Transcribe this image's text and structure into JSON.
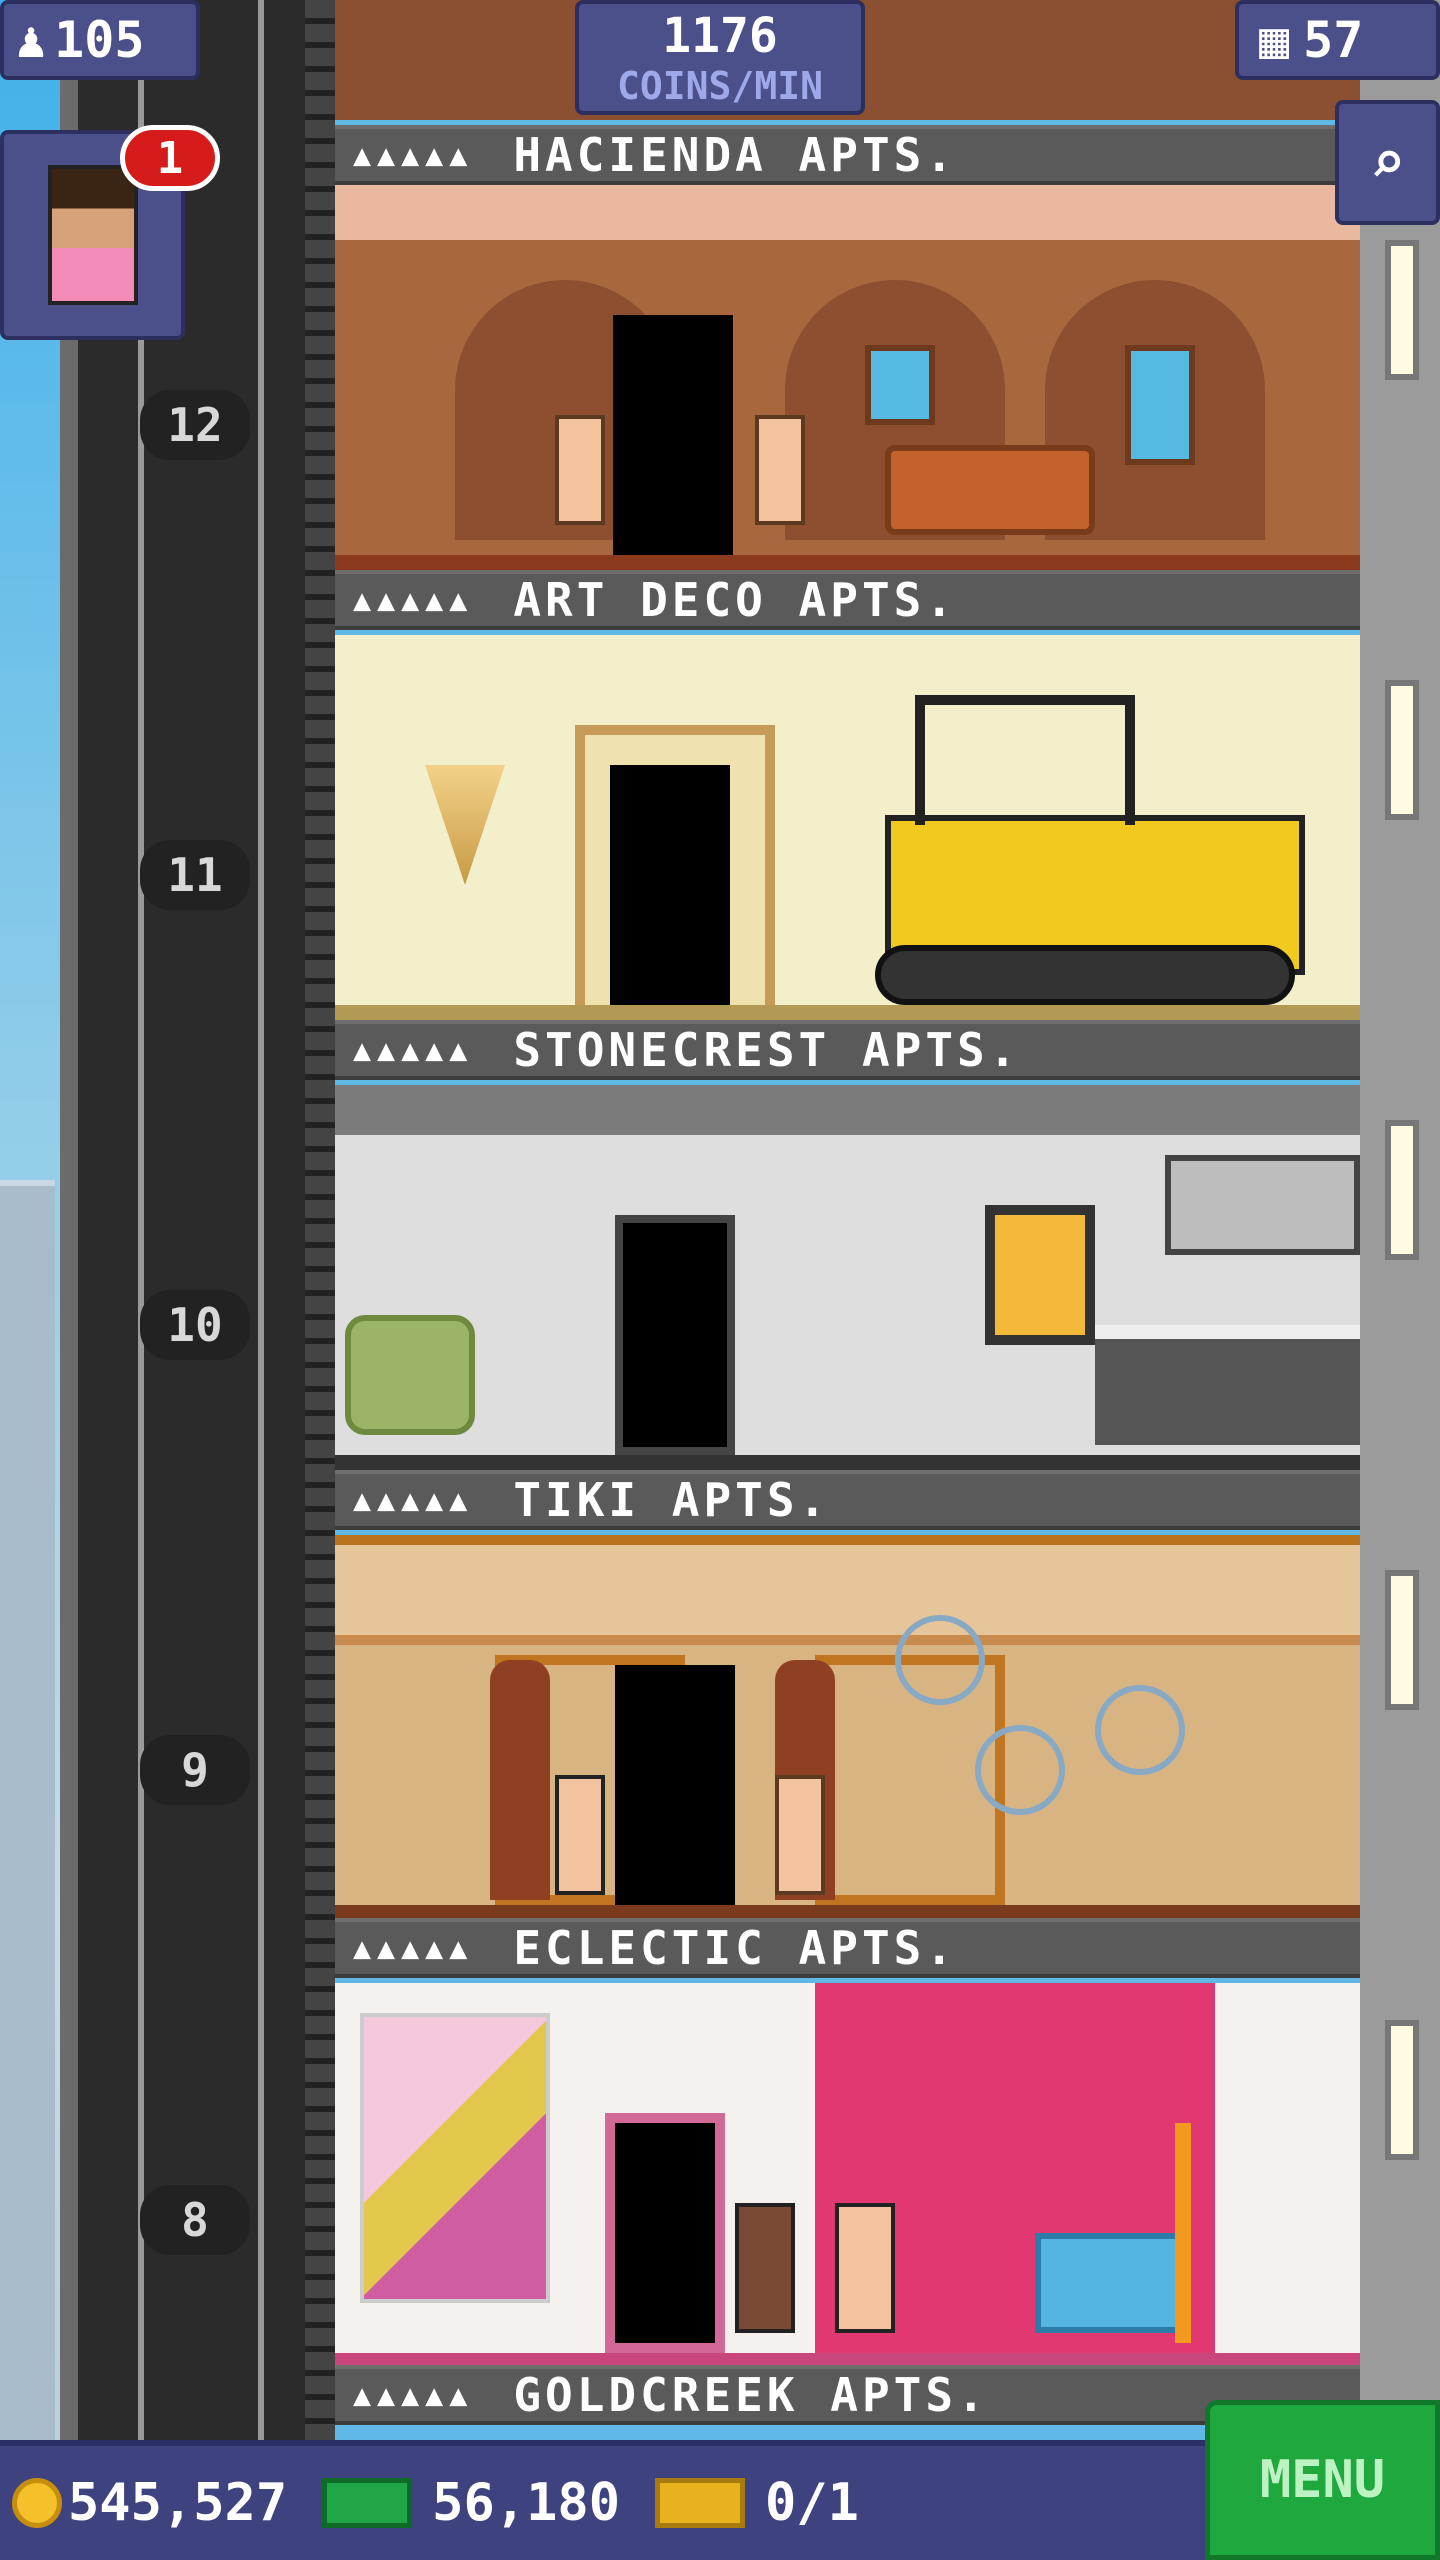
{
  "hud": {
    "population": "105",
    "coins_per_min_value": "1176",
    "coins_per_min_label": "COINS/MIN",
    "floors_count": "57",
    "notification_count": "1"
  },
  "elevator": {
    "floor_numbers": [
      "12",
      "11",
      "10",
      "9",
      "8"
    ]
  },
  "floors": [
    {
      "name": "HACIENDA APTS.",
      "stars": "▲▲▲▲▲"
    },
    {
      "name": "ART DECO APTS.",
      "stars": "▲▲▲▲▲"
    },
    {
      "name": "STONECREST APTS.",
      "stars": "▲▲▲▲▲"
    },
    {
      "name": "TIKI APTS.",
      "stars": "▲▲▲▲▲"
    },
    {
      "name": "ECLECTIC APTS.",
      "stars": "▲▲▲▲▲"
    },
    {
      "name": "GOLDCREEK APTS.",
      "stars": "▲▲▲▲▲"
    }
  ],
  "bottom": {
    "coins": "545,527",
    "bux": "56,180",
    "tickets": "0/1",
    "menu_label": "MENU"
  },
  "colors": {
    "hud": "#4b4f8a",
    "menu": "#1fa83d",
    "badge": "#d61b1b"
  }
}
